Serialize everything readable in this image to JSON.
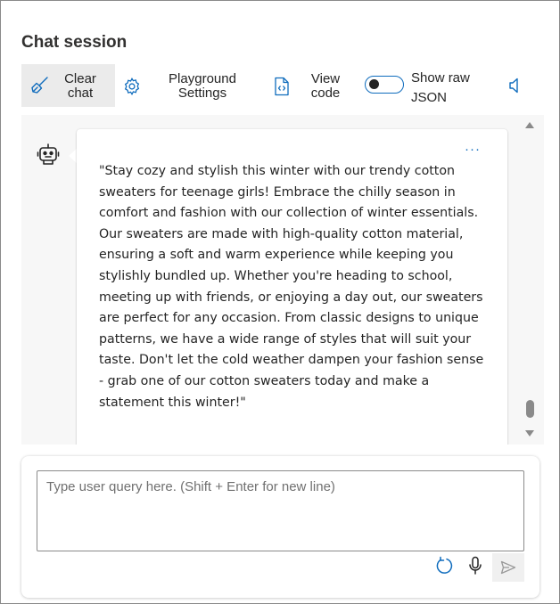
{
  "header": {
    "title": "Chat session"
  },
  "toolbar": {
    "clear_label": "Clear chat",
    "settings_label": "Playground Settings",
    "view_code_label": "View code",
    "raw_json_label": "Show raw JSON",
    "raw_json_on": false,
    "icons": [
      "broom-icon",
      "gear-icon",
      "code-file-icon",
      "speaker-icon"
    ]
  },
  "chat": {
    "messages": [
      {
        "role": "assistant",
        "avatar_icon": "bot-icon",
        "more_label": "···",
        "text": "\"Stay cozy and stylish this winter with our trendy cotton sweaters for teenage girls! Embrace the chilly season in comfort and fashion with our collection of winter essentials. Our sweaters are made with high-quality cotton material, ensuring a soft and warm experience while keeping you stylishly bundled up. Whether you're heading to school, meeting up with friends, or enjoying a day out, our sweaters are perfect for any occasion. From classic designs to unique patterns, we have a wide range of styles that will suit your taste. Don't let the cold weather dampen your fashion sense - grab one of our cotton sweaters today and make a statement this winter!\""
      }
    ]
  },
  "input": {
    "placeholder": "Type user query here. (Shift + Enter for new line)",
    "value": "",
    "icons": [
      "refresh-icon",
      "microphone-icon",
      "send-icon"
    ]
  },
  "colors": {
    "accent": "#0f6cbd",
    "chat_bg": "#f7f7f7",
    "selected_button_bg": "#ebebeb"
  }
}
